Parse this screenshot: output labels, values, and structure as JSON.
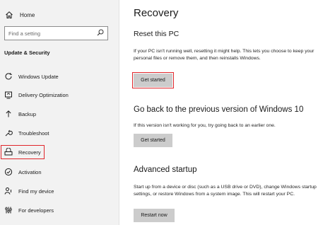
{
  "sidebar": {
    "home_label": "Home",
    "search_placeholder": "Find a setting",
    "section_title": "Update & Security",
    "items": [
      {
        "label": "Windows Update",
        "icon": "refresh-icon"
      },
      {
        "label": "Delivery Optimization",
        "icon": "delivery-optimization-icon"
      },
      {
        "label": "Backup",
        "icon": "backup-arrow-icon"
      },
      {
        "label": "Troubleshoot",
        "icon": "wrench-icon"
      },
      {
        "label": "Recovery",
        "icon": "recovery-drive-icon",
        "selected": true
      },
      {
        "label": "Activation",
        "icon": "check-circle-icon"
      },
      {
        "label": "Find my device",
        "icon": "person-location-icon"
      },
      {
        "label": "For developers",
        "icon": "developer-sliders-icon"
      }
    ]
  },
  "main": {
    "title": "Recovery",
    "reset": {
      "heading": "Reset this PC",
      "description": "If your PC isn't running well, resetting it might help. This lets you choose to keep your personal files or remove them, and then reinstalls Windows.",
      "button": "Get started"
    },
    "goback": {
      "heading": "Go back to the previous version of Windows 10",
      "description": "If this version isn't working for you, try going back to an earlier one.",
      "button": "Get started"
    },
    "advanced": {
      "heading": "Advanced startup",
      "description": "Start up from a device or disc (such as a USB drive or DVD), change Windows startup settings, or restore Windows from a system image. This will restart your PC.",
      "button": "Restart now"
    }
  },
  "colors": {
    "sidebar_bg": "#f2f2f2",
    "button_bg": "#cccccc",
    "highlight": "#e0262b"
  }
}
